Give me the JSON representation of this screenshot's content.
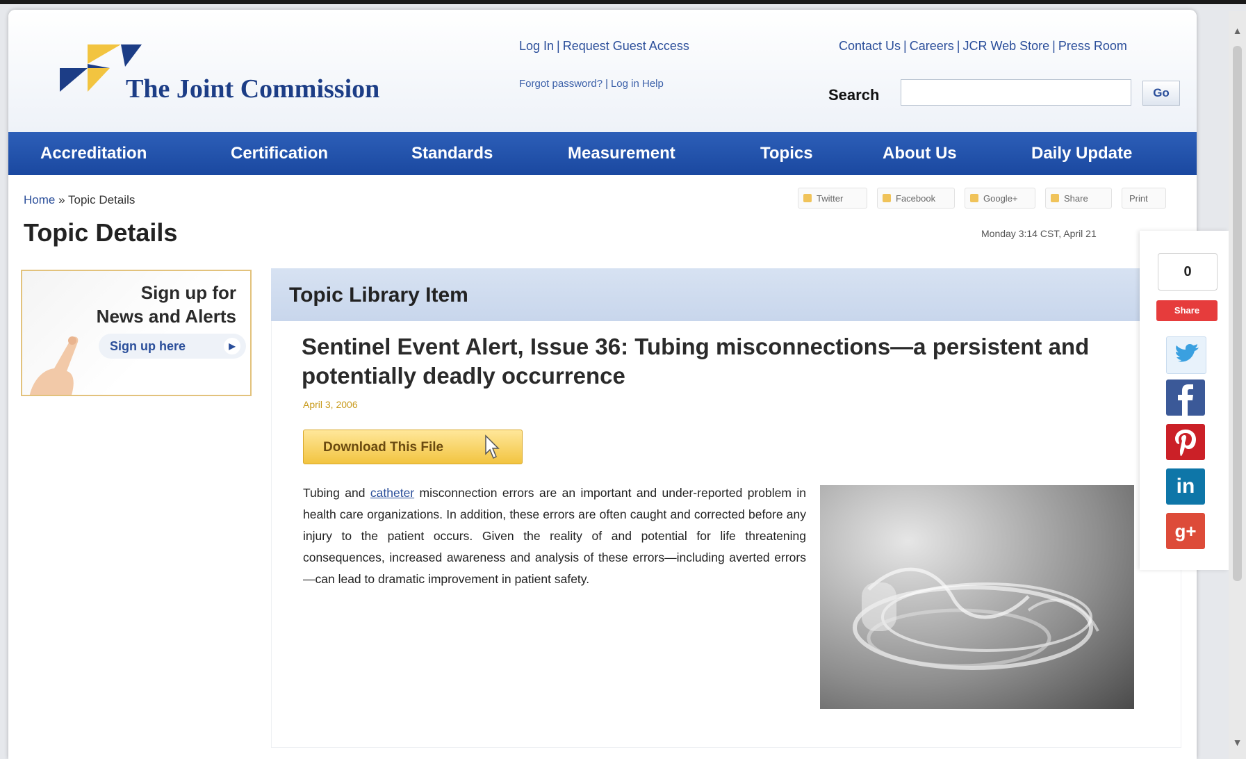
{
  "header": {
    "logo_text": "The Joint Commission",
    "auth_links": [
      "Log In",
      "Request Guest Access"
    ],
    "forgot_links": [
      "Forgot password?",
      "Log in Help"
    ],
    "utility_links": [
      "Contact Us",
      "Careers",
      "JCR Web Store",
      "Press Room"
    ],
    "search_label": "Search",
    "search_placeholder": "",
    "go_label": "Go"
  },
  "nav": {
    "items": [
      "Accreditation",
      "Certification",
      "Standards",
      "Measurement",
      "Topics",
      "About Us",
      "Daily Update"
    ]
  },
  "breadcrumb": {
    "home": "Home",
    "separator": "»",
    "current": "Topic Details"
  },
  "page_title": "Topic Details",
  "share_toolbar": [
    "Twitter",
    "Facebook",
    "Google+",
    "Share",
    "Print"
  ],
  "timestamp": "Monday 3:14 CST, April 21",
  "promo": {
    "title_line1": "Sign up for",
    "title_line2": "News and Alerts",
    "link_label": "Sign up here",
    "arrow": "▶"
  },
  "library": {
    "title": "Topic Library Item"
  },
  "article": {
    "title": "Sentinel Event Alert, Issue 36: Tubing misconnections—a persistent and potentially deadly occurrence",
    "date": "April 3, 2006",
    "download_label": "Download This File",
    "body_before_link": "Tubing and ",
    "body_link": "catheter",
    "body_after_link": " misconnection errors are an important and under-reported problem in health care organizations. In addition, these errors are often caught and corrected before any injury to the patient occurs. Given the reality of and potential for life threatening consequences, increased awareness and analysis of these errors—including averted errors—can lead to dramatic improvement in patient safety."
  },
  "social": {
    "count": "0",
    "share_button": "Share",
    "icons": [
      "twitter-icon",
      "facebook-icon",
      "pinterest-icon",
      "linkedin-icon",
      "google-plus-icon"
    ]
  },
  "colors": {
    "nav_blue": "#1a48a0",
    "brand_navy": "#1c3d86",
    "brand_gold": "#f2c440",
    "library_header": "#c8d6ec"
  }
}
